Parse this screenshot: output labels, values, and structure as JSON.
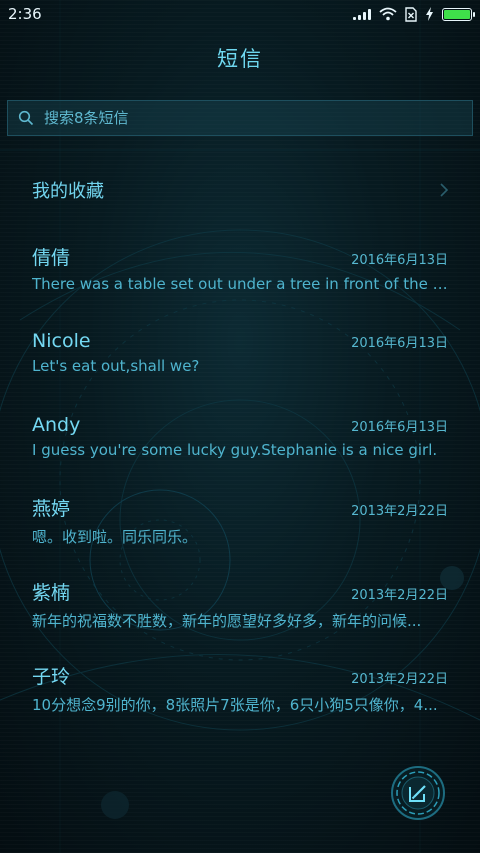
{
  "status_bar": {
    "time": "2:36"
  },
  "header": {
    "title": "短信"
  },
  "search": {
    "placeholder": "搜索8条短信"
  },
  "favorites": {
    "label": "我的收藏"
  },
  "conversations": [
    {
      "name": "倩倩",
      "date": "2016年6月13日",
      "preview": "There was a table set out under a tree in front of the ho..."
    },
    {
      "name": "Nicole",
      "date": "2016年6月13日",
      "preview": "Let's eat out,shall we?"
    },
    {
      "name": "Andy",
      "date": "2016年6月13日",
      "preview": "I guess you're some lucky guy.Stephanie is a nice girl."
    },
    {
      "name": "燕婷",
      "date": "2013年2月22日",
      "preview": "嗯。收到啦。同乐同乐。"
    },
    {
      "name": "紫楠",
      "date": "2013年2月22日",
      "preview": "新年的祝福数不胜数，新年的愿望好多好多，新年的问候..."
    },
    {
      "name": "子玲",
      "date": "2013年2月22日",
      "preview": "10分想念9别的你，8张照片7张是你，6只小狗5只像你，4..."
    }
  ],
  "colors": {
    "accent": "#5fd0ea",
    "background": "#061318",
    "battery": "#3fe04a"
  },
  "icons": {
    "search": "search-icon",
    "chevron": "chevron-right-icon",
    "compose": "compose-icon",
    "wifi": "wifi-icon",
    "sim": "no-sim-icon",
    "charging": "charging-icon",
    "battery": "battery-icon"
  }
}
